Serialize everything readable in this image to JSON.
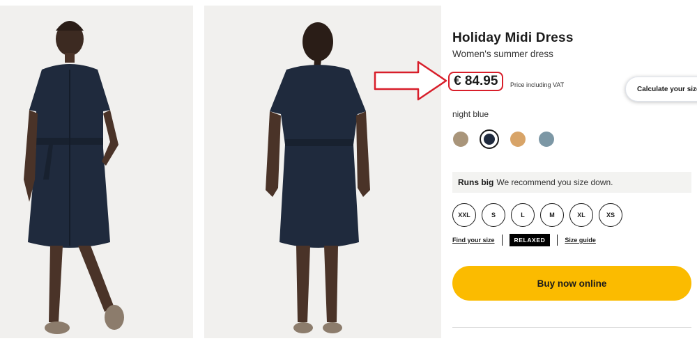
{
  "product": {
    "title": "Holiday Midi Dress",
    "subtitle": "Women's summer dress",
    "price": "€ 84.95",
    "price_note": "Price including VAT",
    "calculate_size_label": "Calculate your size"
  },
  "colors": {
    "selected_name": "night blue",
    "swatches": [
      {
        "name": "sand",
        "hex": "#a9957a"
      },
      {
        "name": "night blue",
        "hex": "#1f2a3d",
        "selected": true
      },
      {
        "name": "orange",
        "hex": "#d8a468"
      },
      {
        "name": "grey blue",
        "hex": "#7c97a5"
      }
    ]
  },
  "fit_notice": {
    "bold": "Runs big",
    "text": "We recommend you size down."
  },
  "sizes": [
    "XXL",
    "S",
    "L",
    "M",
    "XL",
    "XS"
  ],
  "fit_row": {
    "find_size": "Find your size",
    "fit_label": "RELAXED",
    "size_guide": "Size guide"
  },
  "buy_button": "Buy now online",
  "theme": {
    "accent": "#fbbb00",
    "annotation": "#d81e2a",
    "dress": "#1f2a3d"
  }
}
